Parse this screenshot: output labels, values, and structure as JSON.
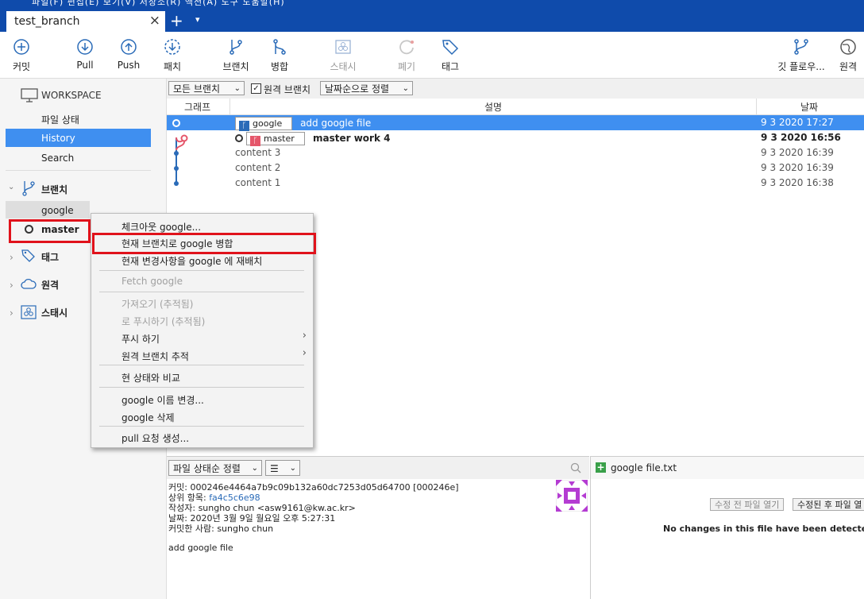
{
  "window": {
    "menu_fragment": "파일(F)   편집(E)   보기(V)   저장소(R)   액션(A)   도구   도움말(H)",
    "tab_title": "test_branch",
    "tab_close": "×",
    "tab_add": "+",
    "tab_dropdown": "▾"
  },
  "toolbar": {
    "commit": "커밋",
    "pull": "Pull",
    "push": "Push",
    "fetch": "패치",
    "branch": "브랜치",
    "merge": "병합",
    "stash": "스태시",
    "discard": "폐기",
    "tag": "태그",
    "gitflow": "깃 플로우...",
    "remote": "원격"
  },
  "sidebar": {
    "workspace": "WORKSPACE",
    "file_status": "파일 상태",
    "history": "History",
    "search": "Search",
    "branches": "브랜치",
    "branch_google": "google",
    "branch_master": "master",
    "tags": "태그",
    "remotes": "원격",
    "stashes": "스태시"
  },
  "filters": {
    "all_branches": "모든 브랜치",
    "remote_branches": "원격 브랜치",
    "sort": "날짜순으로 정렬"
  },
  "columns": {
    "graph": "그래프",
    "description": "설명",
    "date": "날짜"
  },
  "commits": [
    {
      "badge": "google",
      "message": "add google file",
      "date": "9 3 2020 17:27"
    },
    {
      "badge": "master",
      "message": "master work 4",
      "date": "9 3 2020 16:56"
    },
    {
      "message": "content 3",
      "date": "9 3 2020 16:39"
    },
    {
      "message": "content 2",
      "date": "9 3 2020 16:39"
    },
    {
      "message": "content 1",
      "date": "9 3 2020 16:38"
    }
  ],
  "context_menu": {
    "checkout": "체크아웃 google...",
    "merge": "현재 브랜치로 google 병합",
    "rebase": "현재 변경사항을 google 에 재배치",
    "fetch": "Fetch google",
    "pull_tracked": "가져오기 (추적됨)",
    "push_tracked": "로 푸시하기 (추적됨)",
    "push_to": "푸시 하기",
    "track_remote": "원격 브랜치 추적",
    "diff": "현 상태와 비교",
    "rename": "google 이름 변경...",
    "delete": "google 삭제",
    "pull_request": "pull 요청 생성..."
  },
  "bottom": {
    "sort_status": "파일 상태순 정렬",
    "view_mode": "☰",
    "commit_label": "커밋:",
    "commit_value": "000246e4464a7b9c09b132a60dc7253d05d64700 [000246e]",
    "parent_label": "상위 항목:",
    "parent_value": "fa4c5c6e98",
    "author_label": "작성자:",
    "author_value": "sungho chun <asw9161@kw.ac.kr>",
    "date_label": "날짜:",
    "date_value": "2020년 3월 9일 월요일 오후 5:27:31",
    "committer_label": "커밋한 사람:",
    "committer_value": "sungho chun",
    "message": "add google file",
    "file_name": "google file.txt",
    "open_before": "수정 전 파일 열기",
    "open_after": "수정된 후 파일 열",
    "no_changes": "No changes in this file have been detected, or it"
  },
  "colors": {
    "accent": "#0f4bab",
    "selection": "#3f8ff0",
    "highlight": "#e0121b",
    "branch_master": "#e5566a",
    "branch_google": "#2a6bb8"
  }
}
